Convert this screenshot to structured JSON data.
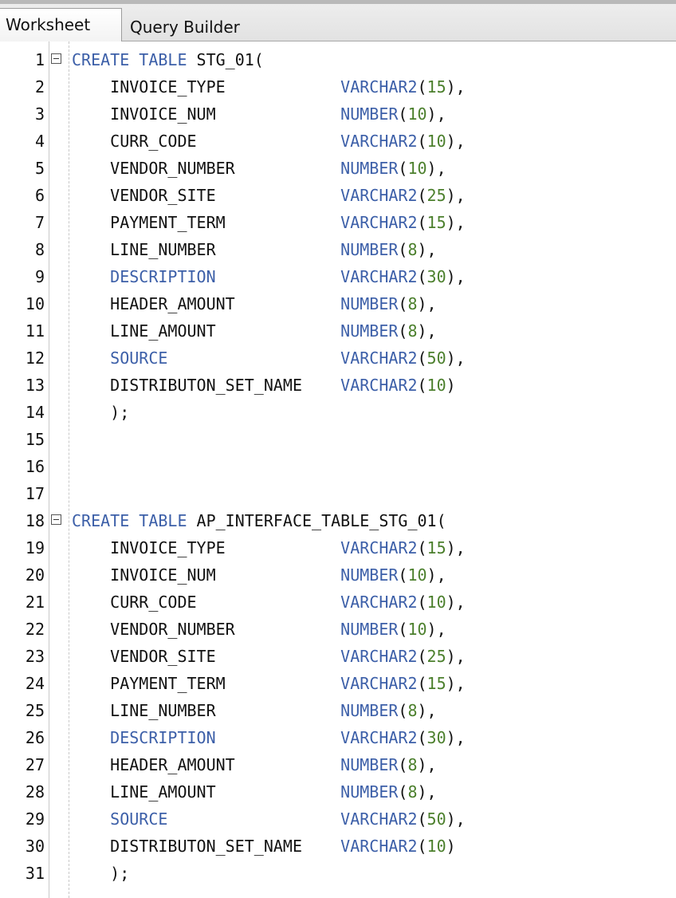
{
  "tabs": [
    {
      "label": "Worksheet",
      "active": true
    },
    {
      "label": "Query Builder",
      "active": false
    }
  ],
  "colors": {
    "keyword": "#3c5fa8",
    "number": "#4b7f2c",
    "plain": "#111111"
  },
  "lines": [
    {
      "n": "1",
      "fold": true,
      "tokens": [
        {
          "t": "CREATE TABLE",
          "c": "kw"
        },
        {
          "t": " STG_01(",
          "c": "pl"
        }
      ]
    },
    {
      "n": "2",
      "tokens": [
        {
          "t": "    INVOICE_TYPE            ",
          "c": "pl"
        },
        {
          "t": "VARCHAR2",
          "c": "kw"
        },
        {
          "t": "(",
          "c": "pl"
        },
        {
          "t": "15",
          "c": "num"
        },
        {
          "t": "),",
          "c": "pl"
        }
      ]
    },
    {
      "n": "3",
      "tokens": [
        {
          "t": "    INVOICE_NUM             ",
          "c": "pl"
        },
        {
          "t": "NUMBER",
          "c": "kw"
        },
        {
          "t": "(",
          "c": "pl"
        },
        {
          "t": "10",
          "c": "num"
        },
        {
          "t": "),",
          "c": "pl"
        }
      ]
    },
    {
      "n": "4",
      "tokens": [
        {
          "t": "    CURR_CODE               ",
          "c": "pl"
        },
        {
          "t": "VARCHAR2",
          "c": "kw"
        },
        {
          "t": "(",
          "c": "pl"
        },
        {
          "t": "10",
          "c": "num"
        },
        {
          "t": "),",
          "c": "pl"
        }
      ]
    },
    {
      "n": "5",
      "tokens": [
        {
          "t": "    VENDOR_NUMBER           ",
          "c": "pl"
        },
        {
          "t": "NUMBER",
          "c": "kw"
        },
        {
          "t": "(",
          "c": "pl"
        },
        {
          "t": "10",
          "c": "num"
        },
        {
          "t": "),",
          "c": "pl"
        }
      ]
    },
    {
      "n": "6",
      "tokens": [
        {
          "t": "    VENDOR_SITE             ",
          "c": "pl"
        },
        {
          "t": "VARCHAR2",
          "c": "kw"
        },
        {
          "t": "(",
          "c": "pl"
        },
        {
          "t": "25",
          "c": "num"
        },
        {
          "t": "),",
          "c": "pl"
        }
      ]
    },
    {
      "n": "7",
      "tokens": [
        {
          "t": "    PAYMENT_TERM            ",
          "c": "pl"
        },
        {
          "t": "VARCHAR2",
          "c": "kw"
        },
        {
          "t": "(",
          "c": "pl"
        },
        {
          "t": "15",
          "c": "num"
        },
        {
          "t": "),",
          "c": "pl"
        }
      ]
    },
    {
      "n": "8",
      "tokens": [
        {
          "t": "    LINE_NUMBER             ",
          "c": "pl"
        },
        {
          "t": "NUMBER",
          "c": "kw"
        },
        {
          "t": "(",
          "c": "pl"
        },
        {
          "t": "8",
          "c": "num"
        },
        {
          "t": "),",
          "c": "pl"
        }
      ]
    },
    {
      "n": "9",
      "tokens": [
        {
          "t": "    ",
          "c": "pl"
        },
        {
          "t": "DESCRIPTION",
          "c": "kw"
        },
        {
          "t": "             ",
          "c": "pl"
        },
        {
          "t": "VARCHAR2",
          "c": "kw"
        },
        {
          "t": "(",
          "c": "pl"
        },
        {
          "t": "30",
          "c": "num"
        },
        {
          "t": "),",
          "c": "pl"
        }
      ]
    },
    {
      "n": "10",
      "tokens": [
        {
          "t": "    HEADER_AMOUNT           ",
          "c": "pl"
        },
        {
          "t": "NUMBER",
          "c": "kw"
        },
        {
          "t": "(",
          "c": "pl"
        },
        {
          "t": "8",
          "c": "num"
        },
        {
          "t": "),",
          "c": "pl"
        }
      ]
    },
    {
      "n": "11",
      "tokens": [
        {
          "t": "    LINE_AMOUNT             ",
          "c": "pl"
        },
        {
          "t": "NUMBER",
          "c": "kw"
        },
        {
          "t": "(",
          "c": "pl"
        },
        {
          "t": "8",
          "c": "num"
        },
        {
          "t": "),",
          "c": "pl"
        }
      ]
    },
    {
      "n": "12",
      "tokens": [
        {
          "t": "    ",
          "c": "pl"
        },
        {
          "t": "SOURCE",
          "c": "kw"
        },
        {
          "t": "                  ",
          "c": "pl"
        },
        {
          "t": "VARCHAR2",
          "c": "kw"
        },
        {
          "t": "(",
          "c": "pl"
        },
        {
          "t": "50",
          "c": "num"
        },
        {
          "t": "),",
          "c": "pl"
        }
      ]
    },
    {
      "n": "13",
      "tokens": [
        {
          "t": "    DISTRIBUTON_SET_NAME    ",
          "c": "pl"
        },
        {
          "t": "VARCHAR2",
          "c": "kw"
        },
        {
          "t": "(",
          "c": "pl"
        },
        {
          "t": "10",
          "c": "num"
        },
        {
          "t": ")",
          "c": "pl"
        }
      ]
    },
    {
      "n": "14",
      "tokens": [
        {
          "t": "    );",
          "c": "pl"
        }
      ]
    },
    {
      "n": "15",
      "tokens": []
    },
    {
      "n": "16",
      "tokens": []
    },
    {
      "n": "17",
      "tokens": []
    },
    {
      "n": "18",
      "fold": true,
      "tokens": [
        {
          "t": "CREATE TABLE",
          "c": "kw"
        },
        {
          "t": " AP_INTERFACE_TABLE_STG_01(",
          "c": "pl"
        }
      ]
    },
    {
      "n": "19",
      "tokens": [
        {
          "t": "    INVOICE_TYPE            ",
          "c": "pl"
        },
        {
          "t": "VARCHAR2",
          "c": "kw"
        },
        {
          "t": "(",
          "c": "pl"
        },
        {
          "t": "15",
          "c": "num"
        },
        {
          "t": "),",
          "c": "pl"
        }
      ]
    },
    {
      "n": "20",
      "tokens": [
        {
          "t": "    INVOICE_NUM             ",
          "c": "pl"
        },
        {
          "t": "NUMBER",
          "c": "kw"
        },
        {
          "t": "(",
          "c": "pl"
        },
        {
          "t": "10",
          "c": "num"
        },
        {
          "t": "),",
          "c": "pl"
        }
      ]
    },
    {
      "n": "21",
      "tokens": [
        {
          "t": "    CURR_CODE               ",
          "c": "pl"
        },
        {
          "t": "VARCHAR2",
          "c": "kw"
        },
        {
          "t": "(",
          "c": "pl"
        },
        {
          "t": "10",
          "c": "num"
        },
        {
          "t": "),",
          "c": "pl"
        }
      ]
    },
    {
      "n": "22",
      "tokens": [
        {
          "t": "    VENDOR_NUMBER           ",
          "c": "pl"
        },
        {
          "t": "NUMBER",
          "c": "kw"
        },
        {
          "t": "(",
          "c": "pl"
        },
        {
          "t": "10",
          "c": "num"
        },
        {
          "t": "),",
          "c": "pl"
        }
      ]
    },
    {
      "n": "23",
      "tokens": [
        {
          "t": "    VENDOR_SITE             ",
          "c": "pl"
        },
        {
          "t": "VARCHAR2",
          "c": "kw"
        },
        {
          "t": "(",
          "c": "pl"
        },
        {
          "t": "25",
          "c": "num"
        },
        {
          "t": "),",
          "c": "pl"
        }
      ]
    },
    {
      "n": "24",
      "tokens": [
        {
          "t": "    PAYMENT_TERM            ",
          "c": "pl"
        },
        {
          "t": "VARCHAR2",
          "c": "kw"
        },
        {
          "t": "(",
          "c": "pl"
        },
        {
          "t": "15",
          "c": "num"
        },
        {
          "t": "),",
          "c": "pl"
        }
      ]
    },
    {
      "n": "25",
      "tokens": [
        {
          "t": "    LINE_NUMBER             ",
          "c": "pl"
        },
        {
          "t": "NUMBER",
          "c": "kw"
        },
        {
          "t": "(",
          "c": "pl"
        },
        {
          "t": "8",
          "c": "num"
        },
        {
          "t": "),",
          "c": "pl"
        }
      ]
    },
    {
      "n": "26",
      "tokens": [
        {
          "t": "    ",
          "c": "pl"
        },
        {
          "t": "DESCRIPTION",
          "c": "kw"
        },
        {
          "t": "             ",
          "c": "pl"
        },
        {
          "t": "VARCHAR2",
          "c": "kw"
        },
        {
          "t": "(",
          "c": "pl"
        },
        {
          "t": "30",
          "c": "num"
        },
        {
          "t": "),",
          "c": "pl"
        }
      ]
    },
    {
      "n": "27",
      "tokens": [
        {
          "t": "    HEADER_AMOUNT           ",
          "c": "pl"
        },
        {
          "t": "NUMBER",
          "c": "kw"
        },
        {
          "t": "(",
          "c": "pl"
        },
        {
          "t": "8",
          "c": "num"
        },
        {
          "t": "),",
          "c": "pl"
        }
      ]
    },
    {
      "n": "28",
      "tokens": [
        {
          "t": "    LINE_AMOUNT             ",
          "c": "pl"
        },
        {
          "t": "NUMBER",
          "c": "kw"
        },
        {
          "t": "(",
          "c": "pl"
        },
        {
          "t": "8",
          "c": "num"
        },
        {
          "t": "),",
          "c": "pl"
        }
      ]
    },
    {
      "n": "29",
      "tokens": [
        {
          "t": "    ",
          "c": "pl"
        },
        {
          "t": "SOURCE",
          "c": "kw"
        },
        {
          "t": "                  ",
          "c": "pl"
        },
        {
          "t": "VARCHAR2",
          "c": "kw"
        },
        {
          "t": "(",
          "c": "pl"
        },
        {
          "t": "50",
          "c": "num"
        },
        {
          "t": "),",
          "c": "pl"
        }
      ]
    },
    {
      "n": "30",
      "tokens": [
        {
          "t": "    DISTRIBUTON_SET_NAME    ",
          "c": "pl"
        },
        {
          "t": "VARCHAR2",
          "c": "kw"
        },
        {
          "t": "(",
          "c": "pl"
        },
        {
          "t": "10",
          "c": "num"
        },
        {
          "t": ")",
          "c": "pl"
        }
      ]
    },
    {
      "n": "31",
      "tokens": [
        {
          "t": "    );",
          "c": "pl"
        }
      ]
    }
  ]
}
